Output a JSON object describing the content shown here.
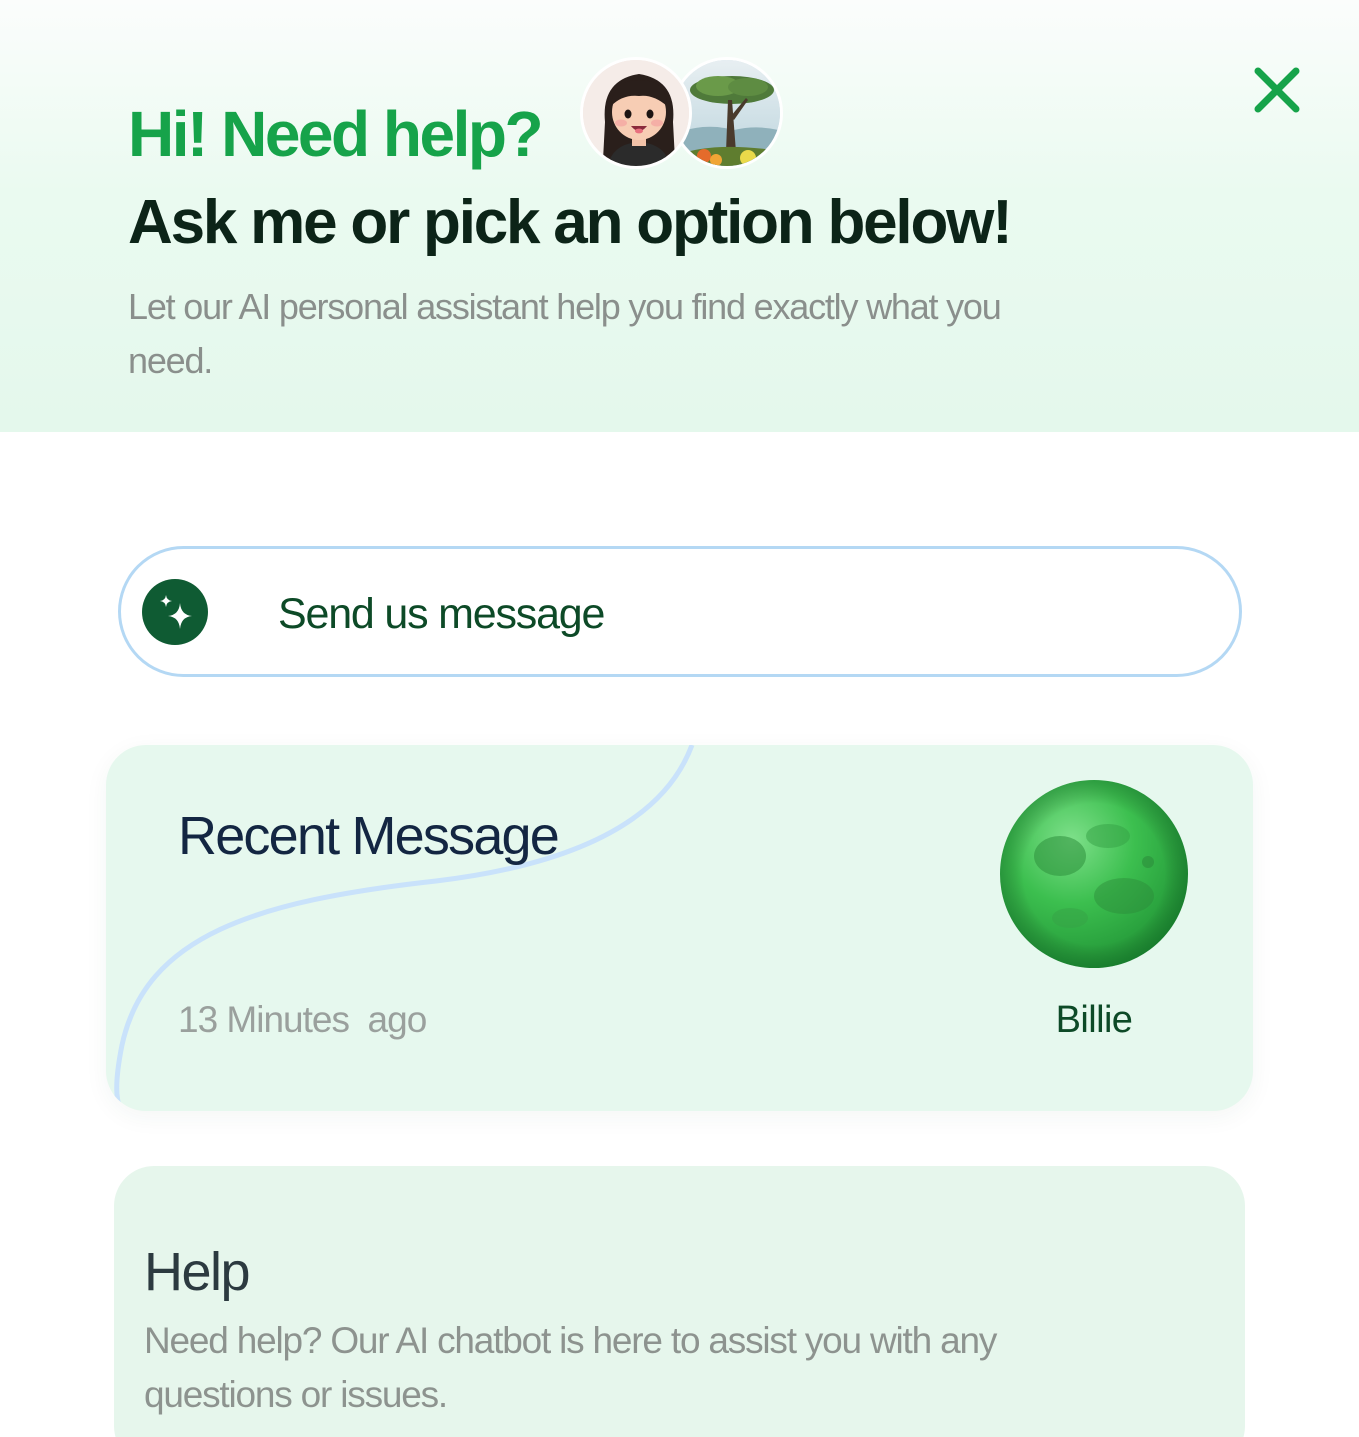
{
  "header": {
    "greeting": "Hi! Need help?",
    "headline": "Ask me or pick an option below!",
    "subtext": "Let our AI personal assistant help you find exactly what you need.",
    "avatars": [
      "girl-avatar",
      "tree-avatar"
    ],
    "close_icon": "close-icon"
  },
  "send": {
    "label": "Send us message",
    "icon": "sparkle-icon"
  },
  "recent": {
    "title": "Recent Message",
    "time": "13 Minutes  ago",
    "agent_name": "Billie",
    "agent_avatar": "green-planet-avatar"
  },
  "help": {
    "title": "Help",
    "text": "Need help? Our AI chatbot is here to assist you with any questions or issues."
  },
  "colors": {
    "accent_green": "#16a34a",
    "dark_green": "#0f5b33",
    "card_bg": "#e6f8ee",
    "pill_border": "#b4d8f4",
    "curve_blue": "#c9e2fb"
  }
}
